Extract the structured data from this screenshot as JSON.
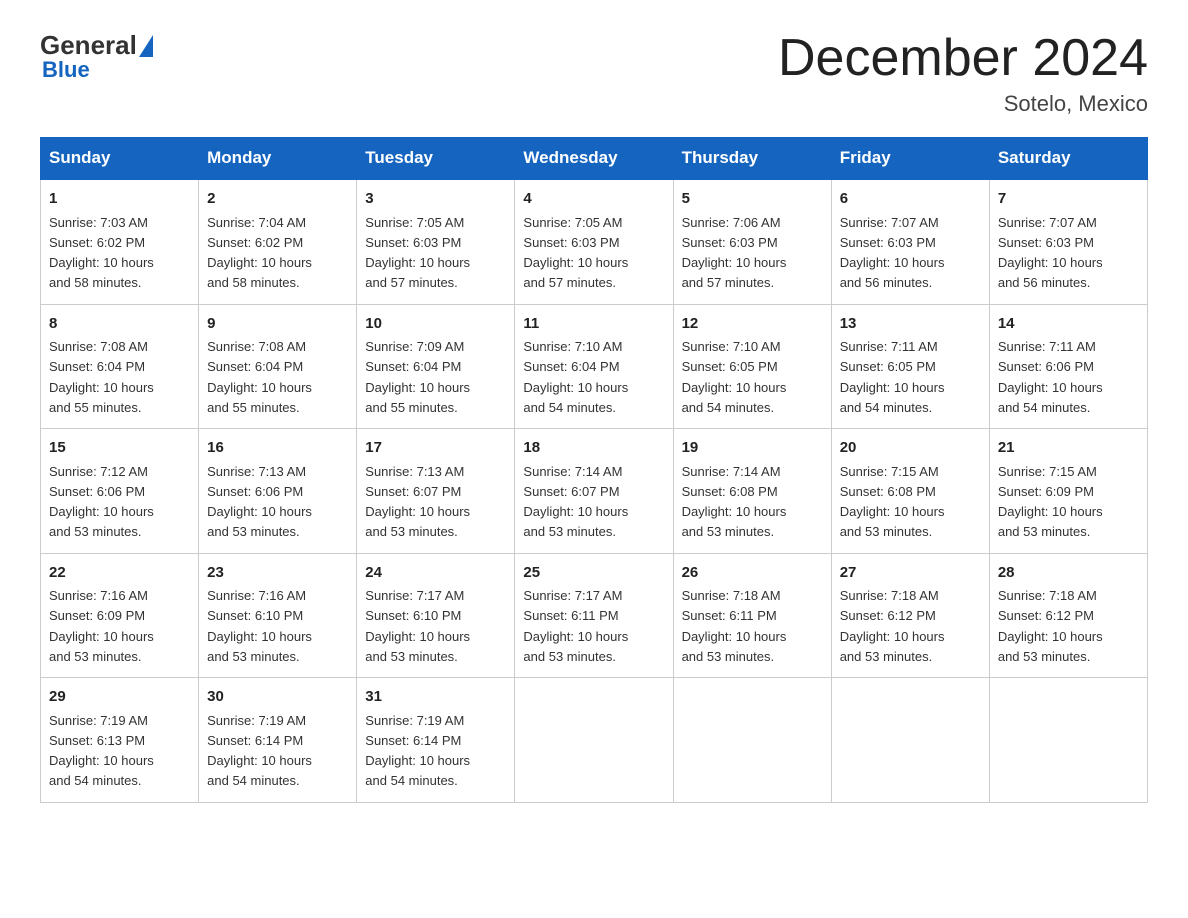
{
  "logo": {
    "general": "General",
    "blue": "Blue"
  },
  "title": "December 2024",
  "subtitle": "Sotelo, Mexico",
  "days_of_week": [
    "Sunday",
    "Monday",
    "Tuesday",
    "Wednesday",
    "Thursday",
    "Friday",
    "Saturday"
  ],
  "weeks": [
    [
      {
        "day": "1",
        "sunrise": "7:03 AM",
        "sunset": "6:02 PM",
        "daylight": "10 hours and 58 minutes."
      },
      {
        "day": "2",
        "sunrise": "7:04 AM",
        "sunset": "6:02 PM",
        "daylight": "10 hours and 58 minutes."
      },
      {
        "day": "3",
        "sunrise": "7:05 AM",
        "sunset": "6:03 PM",
        "daylight": "10 hours and 57 minutes."
      },
      {
        "day": "4",
        "sunrise": "7:05 AM",
        "sunset": "6:03 PM",
        "daylight": "10 hours and 57 minutes."
      },
      {
        "day": "5",
        "sunrise": "7:06 AM",
        "sunset": "6:03 PM",
        "daylight": "10 hours and 57 minutes."
      },
      {
        "day": "6",
        "sunrise": "7:07 AM",
        "sunset": "6:03 PM",
        "daylight": "10 hours and 56 minutes."
      },
      {
        "day": "7",
        "sunrise": "7:07 AM",
        "sunset": "6:03 PM",
        "daylight": "10 hours and 56 minutes."
      }
    ],
    [
      {
        "day": "8",
        "sunrise": "7:08 AM",
        "sunset": "6:04 PM",
        "daylight": "10 hours and 55 minutes."
      },
      {
        "day": "9",
        "sunrise": "7:08 AM",
        "sunset": "6:04 PM",
        "daylight": "10 hours and 55 minutes."
      },
      {
        "day": "10",
        "sunrise": "7:09 AM",
        "sunset": "6:04 PM",
        "daylight": "10 hours and 55 minutes."
      },
      {
        "day": "11",
        "sunrise": "7:10 AM",
        "sunset": "6:04 PM",
        "daylight": "10 hours and 54 minutes."
      },
      {
        "day": "12",
        "sunrise": "7:10 AM",
        "sunset": "6:05 PM",
        "daylight": "10 hours and 54 minutes."
      },
      {
        "day": "13",
        "sunrise": "7:11 AM",
        "sunset": "6:05 PM",
        "daylight": "10 hours and 54 minutes."
      },
      {
        "day": "14",
        "sunrise": "7:11 AM",
        "sunset": "6:06 PM",
        "daylight": "10 hours and 54 minutes."
      }
    ],
    [
      {
        "day": "15",
        "sunrise": "7:12 AM",
        "sunset": "6:06 PM",
        "daylight": "10 hours and 53 minutes."
      },
      {
        "day": "16",
        "sunrise": "7:13 AM",
        "sunset": "6:06 PM",
        "daylight": "10 hours and 53 minutes."
      },
      {
        "day": "17",
        "sunrise": "7:13 AM",
        "sunset": "6:07 PM",
        "daylight": "10 hours and 53 minutes."
      },
      {
        "day": "18",
        "sunrise": "7:14 AM",
        "sunset": "6:07 PM",
        "daylight": "10 hours and 53 minutes."
      },
      {
        "day": "19",
        "sunrise": "7:14 AM",
        "sunset": "6:08 PM",
        "daylight": "10 hours and 53 minutes."
      },
      {
        "day": "20",
        "sunrise": "7:15 AM",
        "sunset": "6:08 PM",
        "daylight": "10 hours and 53 minutes."
      },
      {
        "day": "21",
        "sunrise": "7:15 AM",
        "sunset": "6:09 PM",
        "daylight": "10 hours and 53 minutes."
      }
    ],
    [
      {
        "day": "22",
        "sunrise": "7:16 AM",
        "sunset": "6:09 PM",
        "daylight": "10 hours and 53 minutes."
      },
      {
        "day": "23",
        "sunrise": "7:16 AM",
        "sunset": "6:10 PM",
        "daylight": "10 hours and 53 minutes."
      },
      {
        "day": "24",
        "sunrise": "7:17 AM",
        "sunset": "6:10 PM",
        "daylight": "10 hours and 53 minutes."
      },
      {
        "day": "25",
        "sunrise": "7:17 AM",
        "sunset": "6:11 PM",
        "daylight": "10 hours and 53 minutes."
      },
      {
        "day": "26",
        "sunrise": "7:18 AM",
        "sunset": "6:11 PM",
        "daylight": "10 hours and 53 minutes."
      },
      {
        "day": "27",
        "sunrise": "7:18 AM",
        "sunset": "6:12 PM",
        "daylight": "10 hours and 53 minutes."
      },
      {
        "day": "28",
        "sunrise": "7:18 AM",
        "sunset": "6:12 PM",
        "daylight": "10 hours and 53 minutes."
      }
    ],
    [
      {
        "day": "29",
        "sunrise": "7:19 AM",
        "sunset": "6:13 PM",
        "daylight": "10 hours and 54 minutes."
      },
      {
        "day": "30",
        "sunrise": "7:19 AM",
        "sunset": "6:14 PM",
        "daylight": "10 hours and 54 minutes."
      },
      {
        "day": "31",
        "sunrise": "7:19 AM",
        "sunset": "6:14 PM",
        "daylight": "10 hours and 54 minutes."
      },
      null,
      null,
      null,
      null
    ]
  ],
  "labels": {
    "sunrise": "Sunrise:",
    "sunset": "Sunset:",
    "daylight": "Daylight:"
  }
}
